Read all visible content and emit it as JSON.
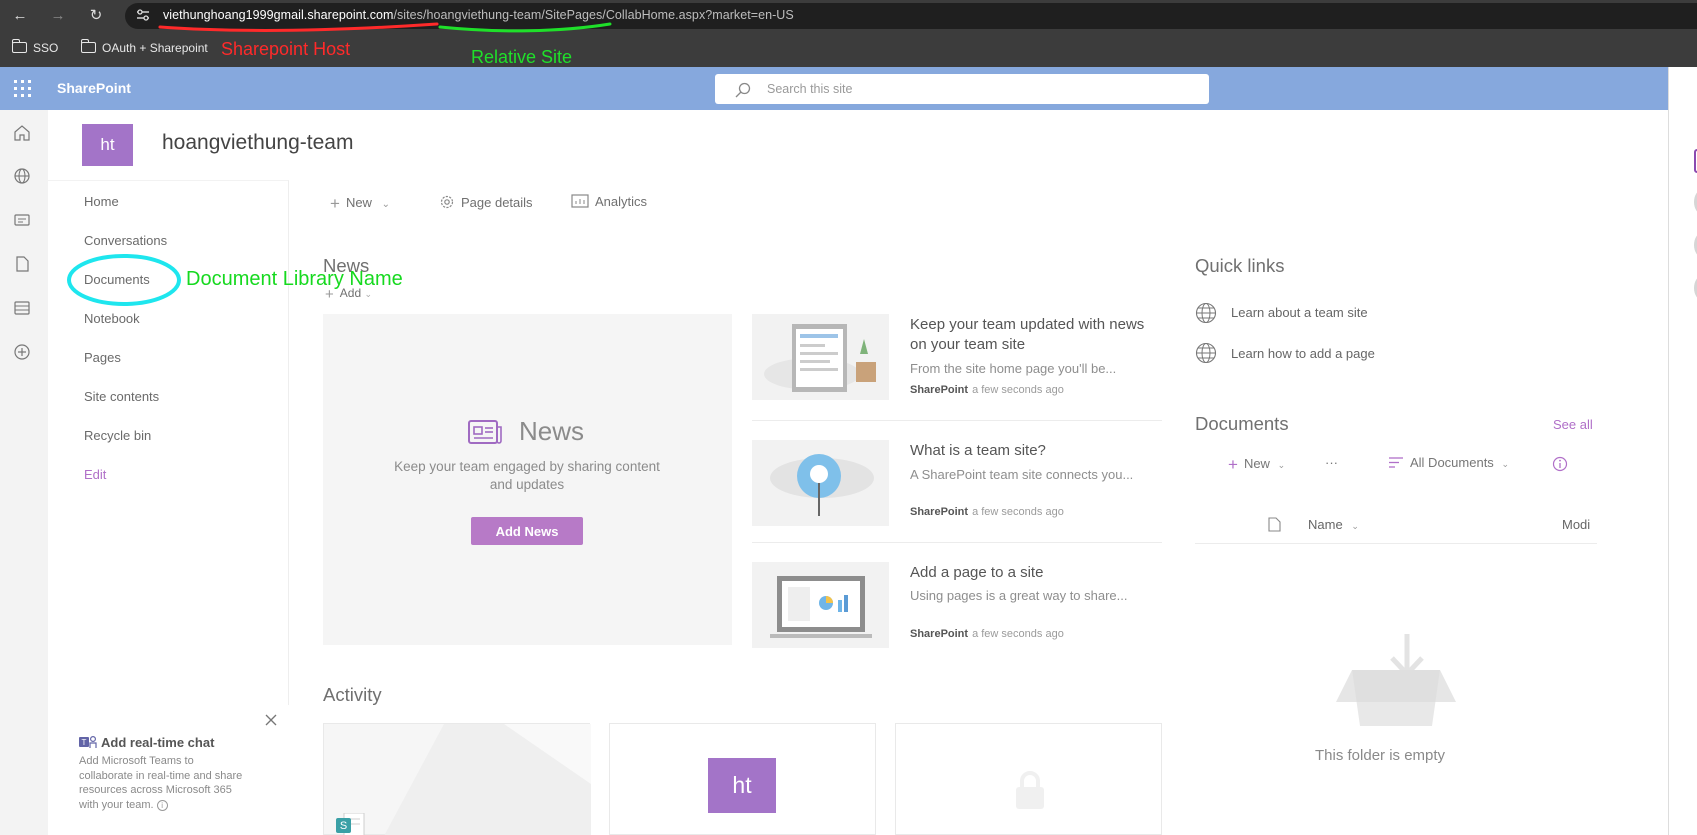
{
  "browser": {
    "url_host": "viethunghoang1999gmail.sharepoint.com",
    "url_path": "/sites/hoangviethung-team/SitePages/CollabHome.aspx?market=en-US",
    "bookmarks": [
      "SSO",
      "OAuth + Sharepoint"
    ]
  },
  "annotations": {
    "host_label": "Sharepoint Host",
    "relative_site_label": "Relative Site",
    "doc_library_label": "Document Library Name",
    "colors": {
      "red": "#ff2a2a",
      "green": "#1fe02a",
      "cyan": "#1ee6ee"
    }
  },
  "suite": {
    "brand": "SharePoint",
    "search_placeholder": "Search this site",
    "bar_color": "#86a8dd"
  },
  "site": {
    "logo_text": "ht",
    "title": "hoangviethung-team",
    "logo_color": "#a374c8"
  },
  "nav": {
    "items": [
      "Home",
      "Conversations",
      "Documents",
      "Notebook",
      "Pages",
      "Site contents",
      "Recycle bin"
    ],
    "edit": "Edit"
  },
  "commands": {
    "new": "New",
    "page_details": "Page details",
    "analytics": "Analytics"
  },
  "news": {
    "heading": "News",
    "add": "Add",
    "placeholder_title": "News",
    "placeholder_text": "Keep your team engaged by sharing content and updates",
    "add_news_button": "Add News",
    "items": [
      {
        "title": "Keep your team updated with news on your team site",
        "desc": "From the site home page you'll be...",
        "source": "SharePoint",
        "time": "a few seconds ago"
      },
      {
        "title": "What is a team site?",
        "desc": "A SharePoint team site connects you...",
        "source": "SharePoint",
        "time": "a few seconds ago"
      },
      {
        "title": "Add a page to a site",
        "desc": "Using pages is a great way to share...",
        "source": "SharePoint",
        "time": "a few seconds ago"
      }
    ]
  },
  "activity": {
    "heading": "Activity",
    "card_logo_text": "ht"
  },
  "chat": {
    "title": "Add real-time chat",
    "desc": "Add Microsoft Teams to collaborate in real-time and share resources across Microsoft 365 with your team."
  },
  "quick_links": {
    "heading": "Quick links",
    "items": [
      "Learn about a team site",
      "Learn how to add a page"
    ]
  },
  "documents": {
    "heading": "Documents",
    "see_all": "See all",
    "new": "New",
    "more": "···",
    "view": "All Documents",
    "col_name": "Name",
    "col_modified": "Modi",
    "empty_text": "This folder is empty"
  }
}
